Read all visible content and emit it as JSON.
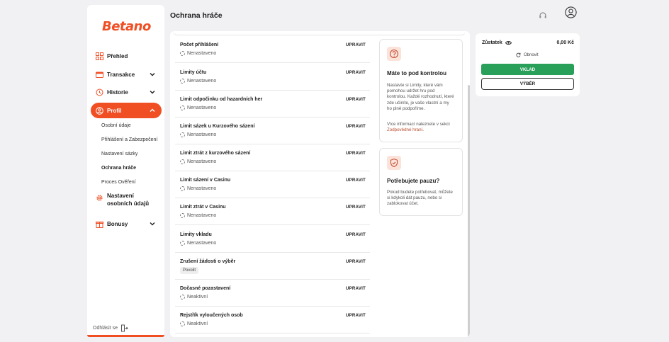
{
  "brand": {
    "logo": "Betano",
    "accent": "#f04e23"
  },
  "header": {
    "title": "Ochrana hráče"
  },
  "sidebar": {
    "items": [
      {
        "label": "Přehled",
        "icon": "grid-icon"
      },
      {
        "label": "Transakce",
        "icon": "wallet-icon"
      },
      {
        "label": "Historie",
        "icon": "history-icon"
      },
      {
        "label": "Profil",
        "icon": "user-icon",
        "active": true
      },
      {
        "label": "Nastavení osobních údajů",
        "icon": "gear-icon"
      },
      {
        "label": "Bonusy",
        "icon": "gift-icon"
      }
    ],
    "profile_sub": [
      {
        "label": "Osobní údaje"
      },
      {
        "label": "Přihlášení a Zabezpečení"
      },
      {
        "label": "Nastavení sázky"
      },
      {
        "label": "Ochrana hráče",
        "current": true
      },
      {
        "label": "Proces Ověření"
      }
    ],
    "logout": "Odhlásit se"
  },
  "limits": [
    {
      "name": "Počet přihlášení",
      "status": "Nenastaveno",
      "action": "UPRAVIT"
    },
    {
      "name": "Limity účtu",
      "status": "Nenastaveno",
      "action": "UPRAVIT"
    },
    {
      "name": "Limit odpočinku od hazardních her",
      "status": "Nenastaveno",
      "action": "UPRAVIT"
    },
    {
      "name": "Limit sázek u Kurzového sázení",
      "status": "Nenastaveno",
      "action": "UPRAVIT"
    },
    {
      "name": "Limit ztrát z kurzového sázení",
      "status": "Nenastaveno",
      "action": "UPRAVIT"
    },
    {
      "name": "Limit sázení v Casinu",
      "status": "Nenastaveno",
      "action": "UPRAVIT"
    },
    {
      "name": "Limit ztrát v Casinu",
      "status": "Nenastaveno",
      "action": "UPRAVIT"
    },
    {
      "name": "Limity vkladu",
      "status": "Nenastaveno",
      "action": "UPRAVIT"
    },
    {
      "name": "Zrušení žádosti o výběr",
      "status": "Povolit",
      "action": "UPRAVIT",
      "badge": true
    },
    {
      "name": "Dočasné pozastavení",
      "status": "Neaktivní",
      "action": "UPRAVIT"
    },
    {
      "name": "Rejstřík vyloučených osob",
      "status": "Neaktivní",
      "action": "UPRAVIT"
    }
  ],
  "info_cards": [
    {
      "title": "Máte to pod kontrolou",
      "icon": "question-icon",
      "text": "Nastavte si Limity, které vám pomohou udržet hru pod kontrolou. Každé rozhodnutí, které zde učiníte, je vaše vlastní a my ho plně podpoříme.",
      "text2_prefix": "Více informací naleznete v sekci ",
      "text2_link": "Zodpovědné hraní",
      "text2_suffix": "."
    },
    {
      "title": "Potřebujete pauzu?",
      "icon": "shield-icon",
      "text": "Pokud budete potřebovat, můžete si kdykoli dát pauzu, nebo si zablokovat účet."
    }
  ],
  "balance": {
    "label": "Zůstatek",
    "amount": "0,00 Kč",
    "refresh": "Obnovit",
    "deposit": "VKLAD",
    "withdraw": "VÝBĚR",
    "deposit_color": "#28a05a"
  }
}
